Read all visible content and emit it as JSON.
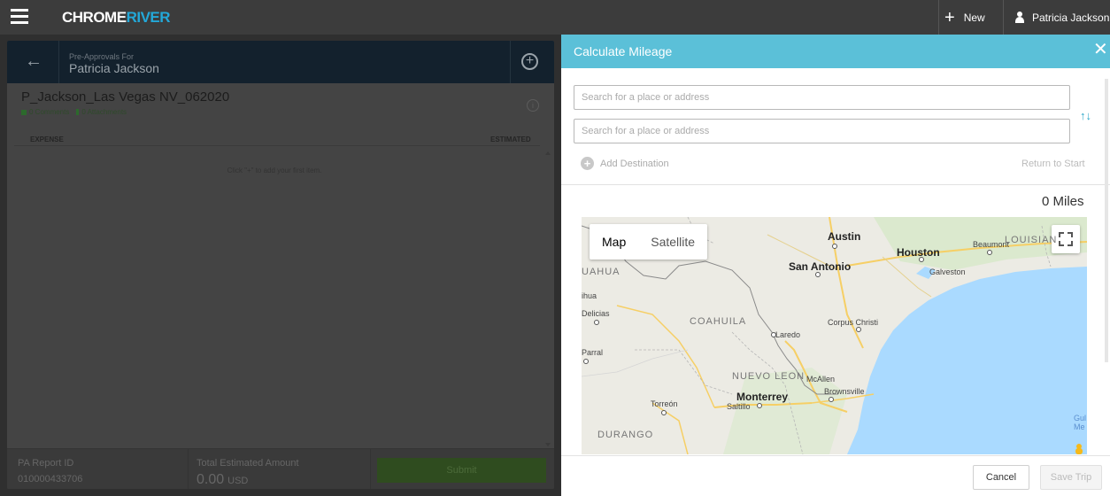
{
  "topbar": {
    "logo_part1": "CHROME",
    "logo_part2": "RIVER",
    "new_label": "New",
    "user_name": "Patricia Jackson"
  },
  "report": {
    "pre_approvals_for": "Pre-Approvals For",
    "owner_name": "Patricia Jackson",
    "title": "P_Jackson_Las Vegas NV_062020",
    "comments": "0 Comments",
    "attachments": "0 Attachments",
    "col_expense": "EXPENSE",
    "col_estimated": "ESTIMATED",
    "empty_message": "Click \"+\" to add your first item.",
    "footer": {
      "report_id_label": "PA Report ID",
      "report_id": "010000433706",
      "total_label": "Total Estimated Amount",
      "total_amount": "0.00",
      "currency": "USD",
      "submit_label": "Submit"
    }
  },
  "mileage": {
    "title": "Calculate Mileage",
    "from_placeholder": "Search for a place or address",
    "to_placeholder": "Search for a place or address",
    "add_destination": "Add Destination",
    "return_to_start": "Return to Start",
    "distance": "0 Miles",
    "cancel_label": "Cancel",
    "save_label": "Save Trip",
    "map": {
      "type_map": "Map",
      "type_satellite": "Satellite",
      "selected_type": "Map",
      "cities": {
        "austin": "Austin",
        "houston": "Houston",
        "beaumont": "Beaumont",
        "san_antonio": "San Antonio",
        "galveston": "Galveston",
        "corpus_christi": "Corpus Christi",
        "laredo": "Laredo",
        "mcallen": "McAllen",
        "brownsville": "Brownsville",
        "monterrey": "Monterrey",
        "saltillo": "Saltillo",
        "torreon": "Torreón",
        "delicias": "Delicias",
        "parral": "Parral",
        "chihuahua_partial": "ihua"
      },
      "regions": {
        "louisiana": "LOUISIAN",
        "chihuahua": "UAHUA",
        "coahuila": "COAHUILA",
        "nuevo_leon": "NUEVO LEON",
        "durango": "DURANGO"
      },
      "water": {
        "gulf_line1": "Gul",
        "gulf_line2": "Me"
      }
    }
  },
  "colors": {
    "topbar": "#3c3c3c",
    "mileage_header": "#5bc0d8",
    "accent_blue": "#23a8d8",
    "water": "#aadaff",
    "submit_green": "#2f4c1f"
  }
}
